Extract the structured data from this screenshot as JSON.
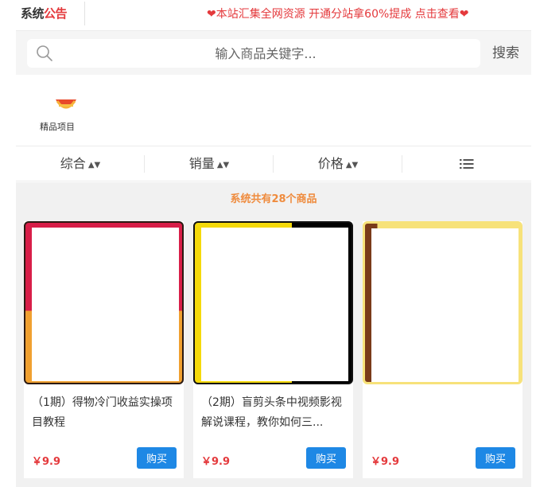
{
  "notice": {
    "label_part1": "系统",
    "label_part2": "公告",
    "text": "❤本站汇集全网资源 开通分站拿60%提成 点击查看❤"
  },
  "search": {
    "placeholder": "输入商品关键字...",
    "button_label": "搜索"
  },
  "categories": [
    {
      "label": "精品项目",
      "icon": "basket-icon"
    }
  ],
  "sort": {
    "items": [
      {
        "label": "综合",
        "arrows": "▲▼"
      },
      {
        "label": "销量",
        "arrows": "▲▼"
      },
      {
        "label": "价格",
        "arrows": "▲▼"
      }
    ],
    "view_icon": "list-icon"
  },
  "summary": {
    "prefix": "系统共有",
    "count": "28",
    "suffix": "个商品"
  },
  "products": [
    {
      "title": "（1期）得物冷门收益实操项目教程",
      "price": "￥9.9",
      "buy_label": "购买",
      "frame_color": "#2b1a12",
      "accent": "#d81e48"
    },
    {
      "title": "（2期）盲剪头条中视频影视解说课程，教你如何三...",
      "price": "￥9.9",
      "buy_label": "购买",
      "frame_color": "#000000",
      "accent": "#f5d90a"
    },
    {
      "title": "",
      "price": "￥9.9",
      "buy_label": "购买",
      "frame_color": "#f7e27a",
      "accent": "#7a3b1a"
    }
  ]
}
